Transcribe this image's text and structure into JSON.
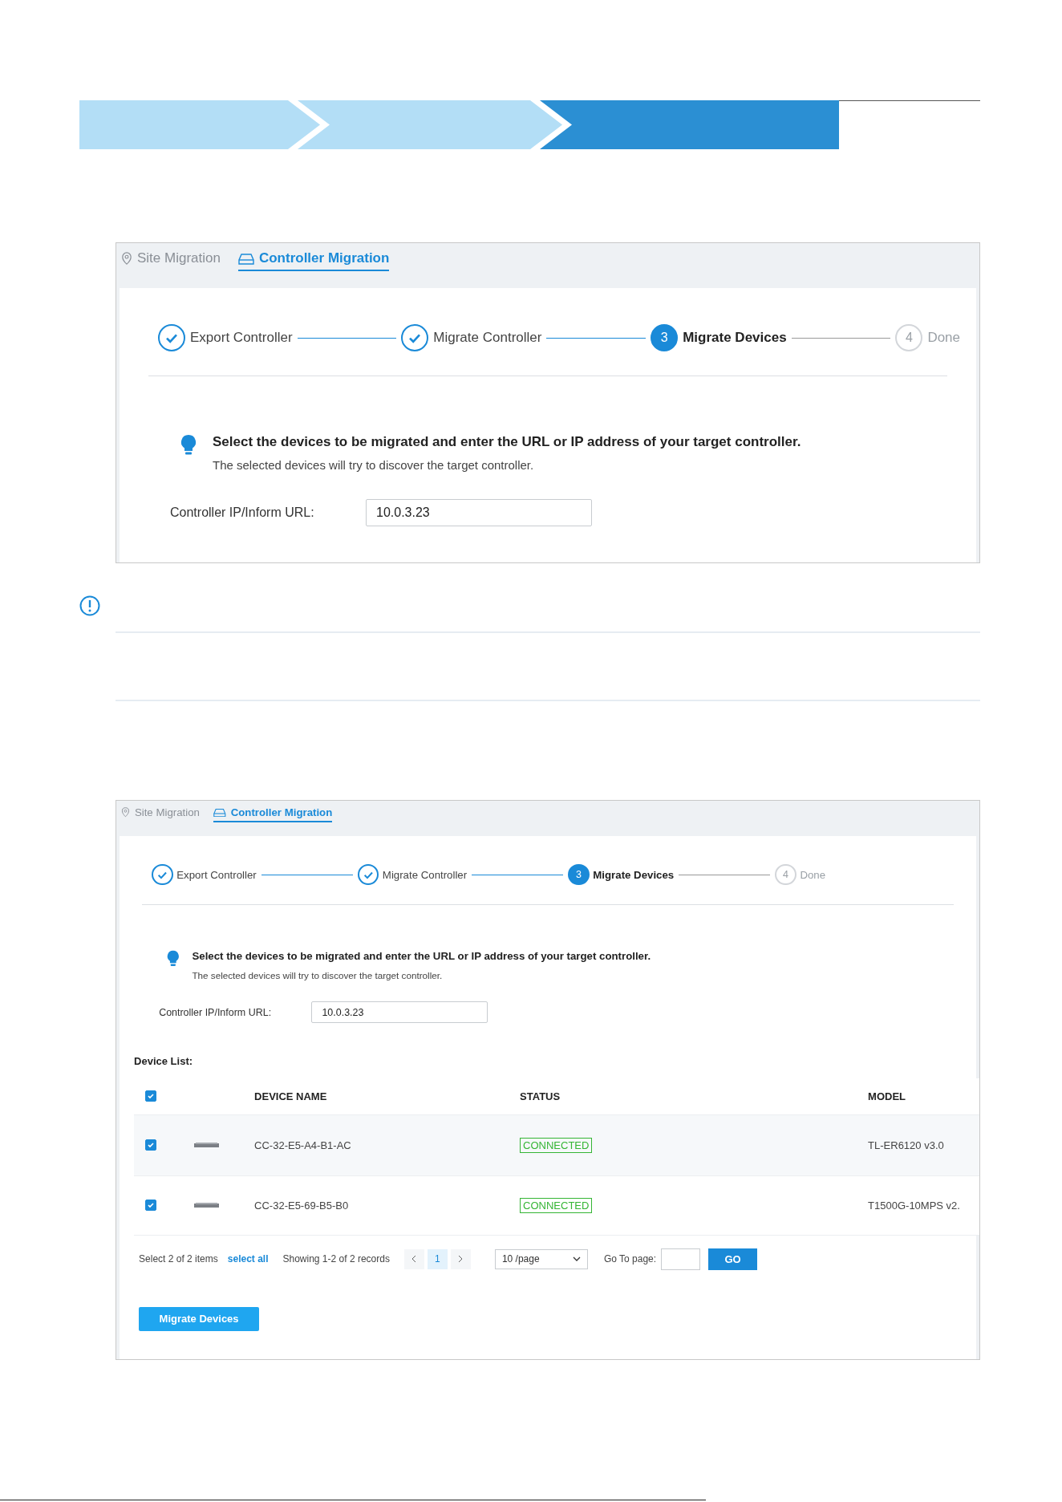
{
  "banner": {
    "segments": [
      {
        "selected": false
      },
      {
        "selected": false
      },
      {
        "selected": true
      }
    ]
  },
  "screenshots": [
    {
      "tabs": [
        {
          "label": "Site Migration",
          "selected": false
        },
        {
          "label": "Controller Migration",
          "selected": true
        }
      ],
      "steps": [
        {
          "label": "Export Controller",
          "kind": "done"
        },
        {
          "label": "Migrate Controller",
          "kind": "done"
        },
        {
          "number": "3",
          "label": "Migrate Devices",
          "kind": "current"
        },
        {
          "number": "4",
          "label": "Done",
          "kind": "pending"
        }
      ],
      "tip": {
        "title": "Select the devices to be migrated and enter the URL or IP address of your target controller.",
        "text": "The selected devices will try to discover the target controller."
      },
      "field": {
        "label": "Controller IP/Inform URL:",
        "value": "10.0.3.23"
      }
    },
    {
      "tabs": [
        {
          "label": "Site Migration",
          "selected": false
        },
        {
          "label": "Controller Migration",
          "selected": true
        }
      ],
      "steps": [
        {
          "label": "Export Controller",
          "kind": "done"
        },
        {
          "label": "Migrate Controller",
          "kind": "done"
        },
        {
          "number": "3",
          "label": "Migrate Devices",
          "kind": "current"
        },
        {
          "number": "4",
          "label": "Done",
          "kind": "pending"
        }
      ],
      "tip": {
        "title": "Select the devices to be migrated and enter the URL or IP address of your target controller.",
        "text": "The selected devices will try to discover the target controller."
      },
      "field": {
        "label": "Controller IP/Inform URL:",
        "value": "10.0.3.23"
      },
      "device_list": {
        "title": "Device List:",
        "all_checked": true,
        "columns": [
          "DEVICE NAME",
          "STATUS",
          "MODEL"
        ],
        "rows": [
          {
            "checked": true,
            "name": "CC-32-E5-A4-B1-AC",
            "status": "CONNECTED",
            "model": "TL-ER6120 v3.0"
          },
          {
            "checked": true,
            "name": "CC-32-E5-69-B5-B0",
            "status": "CONNECTED",
            "model": "T1500G-10MPS v2."
          }
        ],
        "pagination": {
          "selection": "Select 2 of 2 items",
          "select_all": "select all",
          "showing": "Showing 1-2 of 2 records",
          "pages": [
            {
              "label": "1",
              "selected": true
            }
          ],
          "page_size": "10 /page",
          "goto_label": "Go To page:",
          "go": "GO"
        },
        "action": "Migrate Devices"
      }
    }
  ]
}
